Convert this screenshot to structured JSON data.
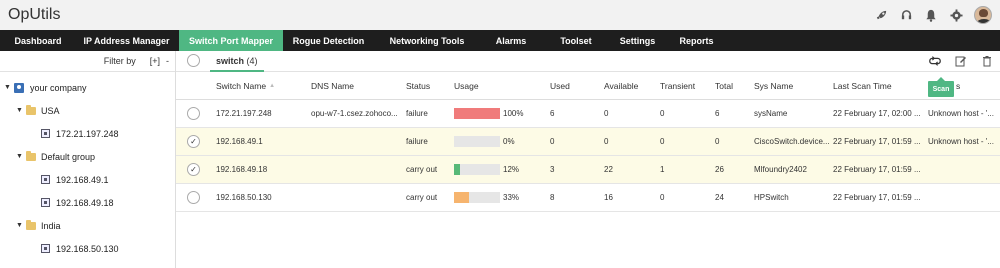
{
  "app": {
    "title": "OpUtils"
  },
  "nav": [
    {
      "label": "Dashboard"
    },
    {
      "label": "IP Address Manager"
    },
    {
      "label": "Switch Port Mapper"
    },
    {
      "label": "Rogue Detection"
    },
    {
      "label": "Networking Tools"
    },
    {
      "label": "Alarms"
    },
    {
      "label": "Toolset"
    },
    {
      "label": "Settings"
    },
    {
      "label": "Reports"
    }
  ],
  "active_tab": "Switch Port Mapper",
  "sidebar": {
    "filter_label": "Filter by",
    "expand_label": "[+]",
    "collapse_label": "-",
    "tree": {
      "root": "your company",
      "groups": [
        {
          "name": "USA",
          "devices": [
            "172.21.197.248"
          ]
        },
        {
          "name": "Default group",
          "devices": [
            "192.168.49.1",
            "192.168.49.18"
          ]
        },
        {
          "name": "India",
          "devices": [
            "192.168.50.130"
          ]
        }
      ]
    }
  },
  "list_tab": {
    "label": "switch",
    "count": "(4)"
  },
  "tooltip": {
    "scan": "Scan"
  },
  "table": {
    "columns": [
      "Switch Name",
      "DNS Name",
      "Status",
      "Usage",
      "Used",
      "Available",
      "Transient",
      "Total",
      "Sys Name",
      "Last Scan Time",
      "s"
    ],
    "sort_indicator": "▲",
    "rows": [
      {
        "selected": false,
        "check": "",
        "switch_name": "172.21.197.248",
        "dns": "opu-w7-1.csez.zohoco...",
        "status": "failure",
        "usage_pct": 100,
        "usage_label": "100%",
        "usage_color": "#f07b7b",
        "used": "6",
        "available": "0",
        "transient": "0",
        "total": "6",
        "sys_name": "sysName",
        "last_scan": "22 February 17, 02:00 ...",
        "extra": "Unknown host - '..."
      },
      {
        "selected": true,
        "check": "✓",
        "switch_name": "192.168.49.1",
        "dns": "",
        "status": "failure",
        "usage_pct": 0,
        "usage_label": "0%",
        "usage_color": "#e6e6e6",
        "used": "0",
        "available": "0",
        "transient": "0",
        "total": "0",
        "sys_name": "CiscoSwitch.device...",
        "last_scan": "22 February 17, 01:59 ...",
        "extra": "Unknown host - '..."
      },
      {
        "selected": true,
        "check": "✓",
        "switch_name": "192.168.49.18",
        "dns": "",
        "status": "carry out",
        "usage_pct": 12,
        "usage_label": "12%",
        "usage_color": "#57b978",
        "used": "3",
        "available": "22",
        "transient": "1",
        "total": "26",
        "sys_name": "Mlfoundry2402",
        "last_scan": "22 February 17, 01:59 ...",
        "extra": ""
      },
      {
        "selected": false,
        "check": "",
        "switch_name": "192.168.50.130",
        "dns": "",
        "status": "carry out",
        "usage_pct": 33,
        "usage_label": "33%",
        "usage_color": "#f6b46e",
        "used": "8",
        "available": "16",
        "transient": "0",
        "total": "24",
        "sys_name": "HPSwitch",
        "last_scan": "22 February 17, 01:59 ...",
        "extra": ""
      }
    ]
  },
  "icons": {
    "top": [
      "rocket-icon",
      "headset-icon",
      "bell-icon",
      "gear-icon",
      "avatar"
    ],
    "tools": [
      "refresh-scan-icon",
      "edit-icon",
      "trash-icon"
    ]
  },
  "colors": {
    "accent": "#4fb783",
    "nav_bg": "#1e1e1e",
    "selected_row": "#fdfbe6"
  }
}
